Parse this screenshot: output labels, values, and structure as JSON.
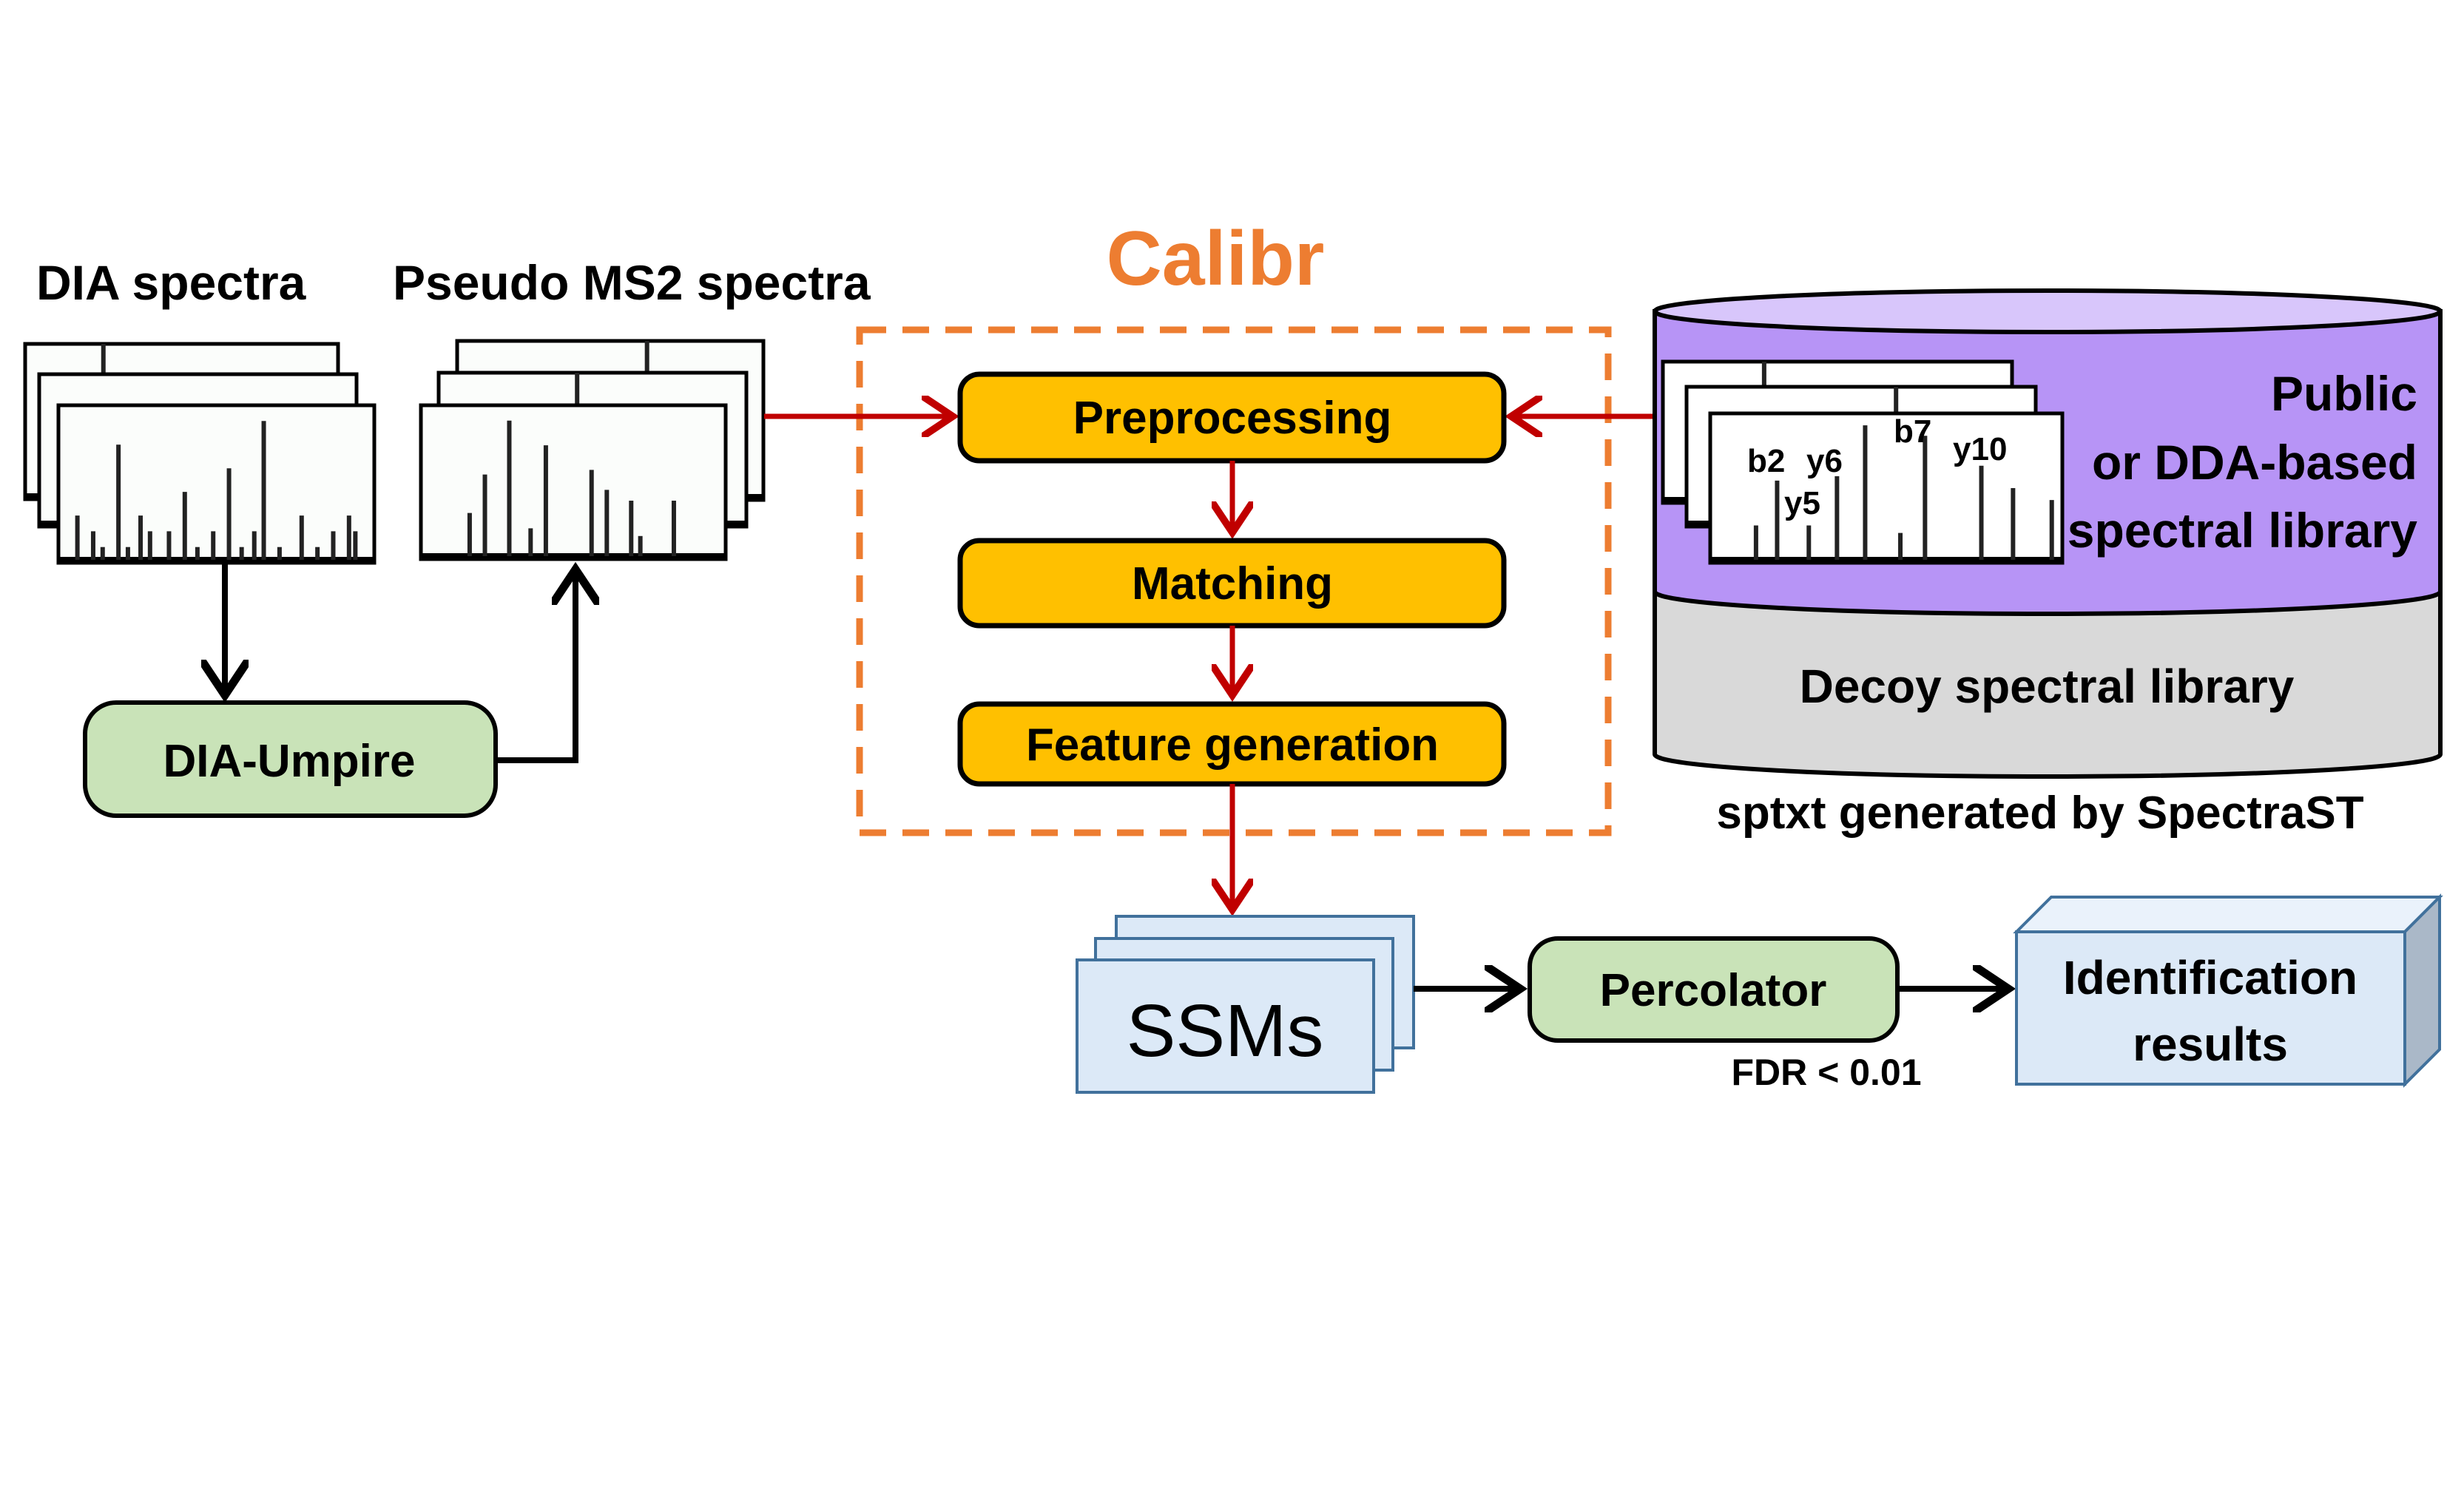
{
  "labels": {
    "dia_spectra": "DIA spectra",
    "pseudo_ms2": "Pseudo MS2 spectra",
    "calibr": "Calibr",
    "dia_umpire": "DIA-Umpire",
    "preprocessing": "Preprocessing",
    "matching": "Matching",
    "feature_generation": "Feature generation",
    "library_line1": "Public",
    "library_line2": "or DDA-based",
    "library_line3": "spectral library",
    "decoy_library": "Decoy spectral library",
    "sptxt": "sptxt generated by SpectraST",
    "ssms": "SSMs",
    "percolator": "Percolator",
    "fdr": "FDR < 0.01",
    "identification_line1": "Identification",
    "identification_line2": "results"
  },
  "peak_labels": {
    "b2": "b2",
    "y6": "y6",
    "y5": "y5",
    "b7": "b7",
    "y10": "y10"
  },
  "colors": {
    "calibr_orange": "#ed7d31",
    "step_fill": "#ffc000",
    "green_fill": "#c9e3b8",
    "purple": "#b794f6",
    "purple_top": "#d8c6fb",
    "grey": "#d9d9d9",
    "blue_fill": "#dce9f7",
    "blue_stroke": "#41719c",
    "red_arrow": "#c00000"
  }
}
